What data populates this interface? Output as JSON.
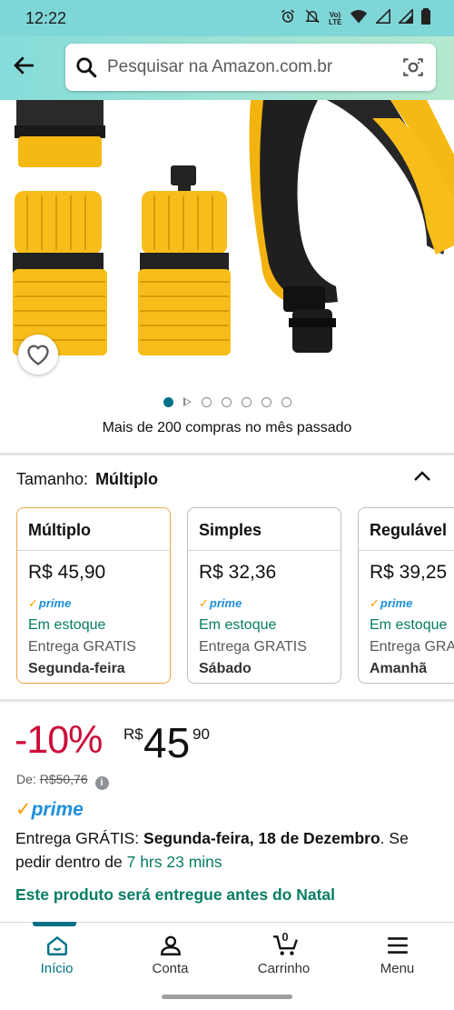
{
  "status_bar": {
    "time": "12:22",
    "icons": [
      "alarm-icon",
      "mute-icon",
      "volte-icon",
      "wifi-icon",
      "signal-icon",
      "signal-icon",
      "battery-icon"
    ],
    "volte_label": "Vo) LTE"
  },
  "header": {
    "search_placeholder": "Pesquisar na Amazon.com.br"
  },
  "gallery": {
    "dot_count": 7,
    "active_index": 0
  },
  "bought_text": "Mais de 200 compras no mês passado",
  "size": {
    "label": "Tamanho:",
    "selected": "Múltiplo",
    "options": [
      {
        "title": "Múltiplo",
        "price": "R$ 45,90",
        "prime": "prime",
        "stock": "Em estoque",
        "shipping": "Entrega GRATIS",
        "day": "Segunda-feira"
      },
      {
        "title": "Simples",
        "price": "R$ 32,36",
        "prime": "prime",
        "stock": "Em estoque",
        "shipping": "Entrega GRATIS",
        "day": "Sábado"
      },
      {
        "title": "Regulável",
        "price": "R$ 39,25",
        "prime": "prime",
        "stock": "Em estoque",
        "shipping": "Entrega GRATIS",
        "day": "Amanhã"
      }
    ]
  },
  "price": {
    "discount": "-10%",
    "currency": "R$",
    "whole": "45",
    "fraction": "90",
    "was_label": "De:",
    "was_price": "R$50,76"
  },
  "prime_label": "prime",
  "delivery": {
    "prefix": "Entrega GRÁTIS: ",
    "date": "Segunda-feira, 18 de Dezembro",
    "middle": ". Se pedir dentro de ",
    "countdown": "7 hrs 23 mins"
  },
  "christmas_note": "Este produto será entregue antes do Natal",
  "bottom_nav": {
    "home": "Início",
    "account": "Conta",
    "cart": "Carrinho",
    "cart_count": "0",
    "menu": "Menu"
  },
  "colors": {
    "accent": "#007185",
    "discount": "#cc0c39",
    "prime_blue": "#1f8eda",
    "stock_green": "#067d62",
    "selected_border": "#f0a44a"
  }
}
